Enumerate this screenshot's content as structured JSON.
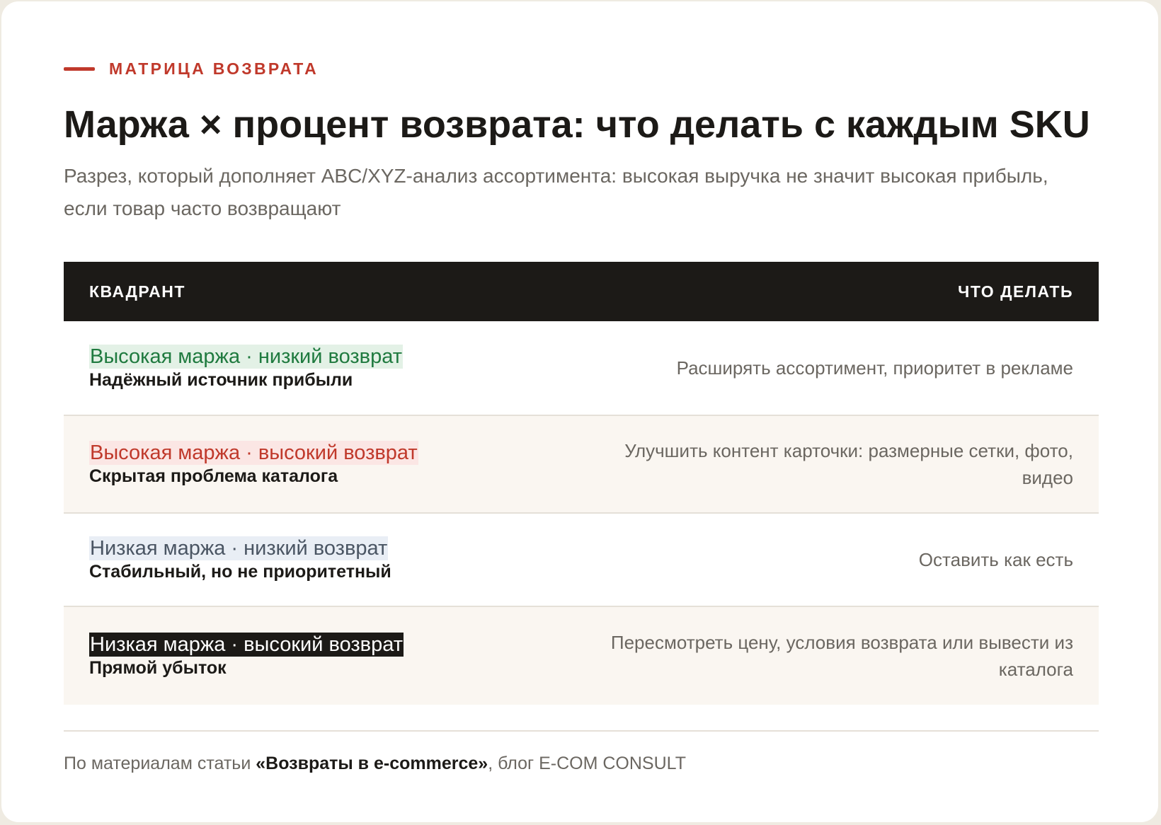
{
  "eyebrow": "МАТРИЦА ВОЗВРАТА",
  "title": "Маржа × процент возврата: что делать с каждым SKU",
  "subtitle": "Разрез, который дополняет ABC/XYZ-анализ ассортимента: высокая выручка не значит высокая прибыль, если товар часто возвращают",
  "table": {
    "header": {
      "col1": "КВАДРАНТ",
      "col2": "ЧТО ДЕЛАТЬ"
    },
    "rows": [
      {
        "tag": "Высокая маржа · низкий возврат",
        "name": "Надёжный источник прибыли",
        "action": "Расширять ассортимент, приоритет в рекламе",
        "tag_color": "#1f7a3f",
        "tag_bg": "#e3f1e6"
      },
      {
        "tag": "Высокая маржа · высокий возврат",
        "name": "Скрытая проблема каталога",
        "action": "Улучшить контент карточки: размерные сетки, фото, видео",
        "tag_color": "#c0392b",
        "tag_bg": "#fbe6e4"
      },
      {
        "tag": "Низкая маржа · низкий возврат",
        "name": "Стабильный, но не приоритетный",
        "action": "Оставить как есть",
        "tag_color": "#4a5563",
        "tag_bg": "#e9eef5"
      },
      {
        "tag": "Низкая маржа · высокий возврат",
        "name": "Прямой убыток",
        "action": "Пересмотреть цену, условия возврата или вывести из каталога",
        "tag_color": "#ffffff",
        "tag_bg": "#1c1a17"
      }
    ]
  },
  "footer": {
    "prefix": "По материалам статьи ",
    "article": "«Возвраты в e-commerce»",
    "suffix": ", блог E-COM CONSULT"
  },
  "colors": {
    "accent": "#c0392b",
    "dark": "#1c1a17",
    "muted_text": "#6b6761",
    "page_background": "#efebe2",
    "alt_row": "#faf6f1"
  }
}
